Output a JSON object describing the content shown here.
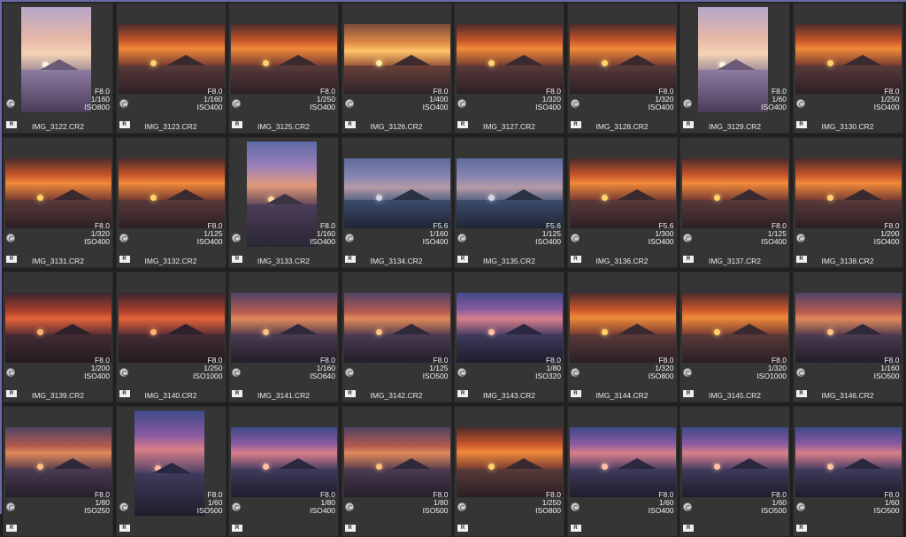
{
  "raw_badge": "R",
  "rotate_icon": "rotate-icon",
  "colors": {
    "background": "#202020",
    "cell": "#353535",
    "border_accent": "#6a6aa8"
  },
  "thumbnails": [
    {
      "name": "IMG_3122.CR2",
      "aperture": "F8.0",
      "shutter": "1/160",
      "iso": "ISO800",
      "orientation": "portrait",
      "palette": "pale"
    },
    {
      "name": "IMG_3123.CR2",
      "aperture": "F8.0",
      "shutter": "1/160",
      "iso": "ISO400",
      "orientation": "landscape",
      "palette": "orange"
    },
    {
      "name": "IMG_3125.CR2",
      "aperture": "F8.0",
      "shutter": "1/250",
      "iso": "ISO400",
      "orientation": "landscape",
      "palette": "orange"
    },
    {
      "name": "IMG_3126.CR2",
      "aperture": "F8.0",
      "shutter": "1/400",
      "iso": "ISO400",
      "orientation": "landscape",
      "palette": "gold"
    },
    {
      "name": "IMG_3127.CR2",
      "aperture": "F8.0",
      "shutter": "1/320",
      "iso": "ISO400",
      "orientation": "landscape",
      "palette": "orange"
    },
    {
      "name": "IMG_3128.CR2",
      "aperture": "F8.0",
      "shutter": "1/320",
      "iso": "ISO400",
      "orientation": "landscape",
      "palette": "orange"
    },
    {
      "name": "IMG_3129.CR2",
      "aperture": "F8.0",
      "shutter": "1/60",
      "iso": "ISO400",
      "orientation": "portrait",
      "palette": "pale"
    },
    {
      "name": "IMG_3130.CR2",
      "aperture": "F8.0",
      "shutter": "1/250",
      "iso": "ISO400",
      "orientation": "landscape",
      "palette": "orange"
    },
    {
      "name": "IMG_3131.CR2",
      "aperture": "F8.0",
      "shutter": "1/320",
      "iso": "ISO400",
      "orientation": "landscape",
      "palette": "orange"
    },
    {
      "name": "IMG_3132.CR2",
      "aperture": "F8.0",
      "shutter": "1/125",
      "iso": "ISO400",
      "orientation": "landscape",
      "palette": "orange"
    },
    {
      "name": "IMG_3133.CR2",
      "aperture": "F8.0",
      "shutter": "1/160",
      "iso": "ISO400",
      "orientation": "portrait",
      "palette": "purple"
    },
    {
      "name": "IMG_3134.CR2",
      "aperture": "F5.6",
      "shutter": "1/160",
      "iso": "ISO400",
      "orientation": "landscape",
      "palette": "blue"
    },
    {
      "name": "IMG_3135.CR2",
      "aperture": "F5.6",
      "shutter": "1/125",
      "iso": "ISO400",
      "orientation": "landscape",
      "palette": "blue"
    },
    {
      "name": "IMG_3136.CR2",
      "aperture": "F5.6",
      "shutter": "1/300",
      "iso": "ISO400",
      "orientation": "landscape",
      "palette": "orange"
    },
    {
      "name": "IMG_3137.CR2",
      "aperture": "F8.0",
      "shutter": "1/125",
      "iso": "ISO400",
      "orientation": "landscape",
      "palette": "orange"
    },
    {
      "name": "IMG_3138.CR2",
      "aperture": "F8.0",
      "shutter": "1/200",
      "iso": "ISO400",
      "orientation": "landscape",
      "palette": "orange"
    },
    {
      "name": "IMG_3139.CR2",
      "aperture": "F8.0",
      "shutter": "1/200",
      "iso": "ISO400",
      "orientation": "landscape",
      "palette": "red"
    },
    {
      "name": "IMG_3140.CR2",
      "aperture": "F8.0",
      "shutter": "1/250",
      "iso": "ISO1000",
      "orientation": "landscape",
      "palette": "red"
    },
    {
      "name": "IMG_3141.CR2",
      "aperture": "F8.0",
      "shutter": "1/160",
      "iso": "ISO640",
      "orientation": "landscape",
      "palette": "dusk"
    },
    {
      "name": "IMG_3142.CR2",
      "aperture": "F8.0",
      "shutter": "1/125",
      "iso": "ISO500",
      "orientation": "landscape",
      "palette": "dusk"
    },
    {
      "name": "IMG_3143.CR2",
      "aperture": "F8.0",
      "shutter": "1/80",
      "iso": "ISO320",
      "orientation": "landscape",
      "palette": "violet"
    },
    {
      "name": "IMG_3144.CR2",
      "aperture": "F8.0",
      "shutter": "1/320",
      "iso": "ISO800",
      "orientation": "landscape",
      "palette": "orange"
    },
    {
      "name": "IMG_3145.CR2",
      "aperture": "F8.0",
      "shutter": "1/320",
      "iso": "ISO1000",
      "orientation": "landscape",
      "palette": "orange"
    },
    {
      "name": "IMG_3146.CR2",
      "aperture": "F8.0",
      "shutter": "1/160",
      "iso": "ISO500",
      "orientation": "landscape",
      "palette": "dusk"
    },
    {
      "name": "",
      "aperture": "F8.0",
      "shutter": "1/80",
      "iso": "ISO250",
      "orientation": "landscape",
      "palette": "dusk"
    },
    {
      "name": "",
      "aperture": "F8.0",
      "shutter": "1/60",
      "iso": "ISO500",
      "orientation": "portrait",
      "palette": "violet"
    },
    {
      "name": "",
      "aperture": "F8.0",
      "shutter": "1/80",
      "iso": "ISO400",
      "orientation": "landscape",
      "palette": "violet"
    },
    {
      "name": "",
      "aperture": "F8.0",
      "shutter": "1/80",
      "iso": "ISO500",
      "orientation": "landscape",
      "palette": "dusk"
    },
    {
      "name": "",
      "aperture": "F8.0",
      "shutter": "1/250",
      "iso": "ISO800",
      "orientation": "landscape",
      "palette": "orange"
    },
    {
      "name": "",
      "aperture": "F8.0",
      "shutter": "1/60",
      "iso": "ISO400",
      "orientation": "landscape",
      "palette": "violet"
    },
    {
      "name": "",
      "aperture": "F8.0",
      "shutter": "1/60",
      "iso": "ISO500",
      "orientation": "landscape",
      "palette": "violet"
    },
    {
      "name": "",
      "aperture": "F8.0",
      "shutter": "1/60",
      "iso": "ISO500",
      "orientation": "landscape",
      "palette": "violet"
    }
  ]
}
